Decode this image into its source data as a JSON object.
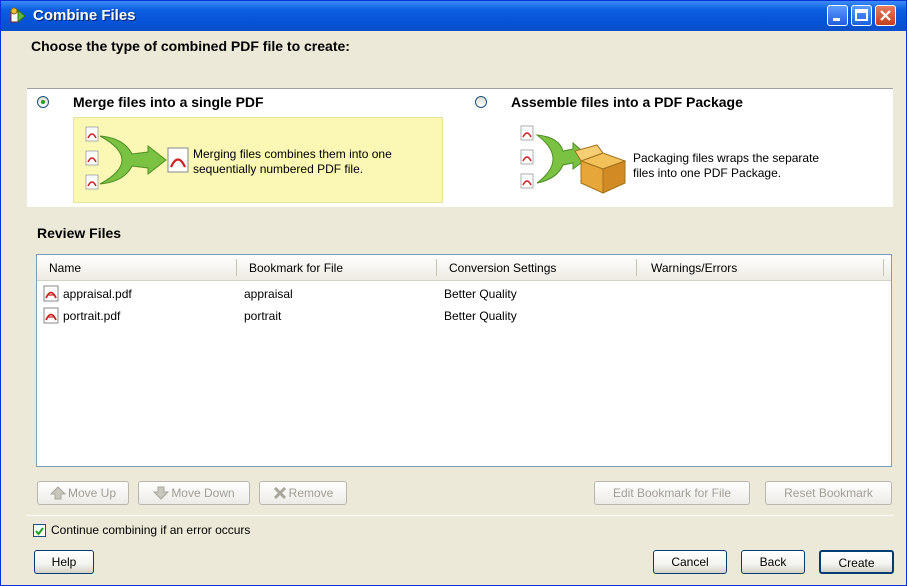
{
  "window": {
    "title": "Combine Files"
  },
  "heading": "Choose the type of combined PDF file to create:",
  "options": {
    "merge": {
      "label": "Merge files into a single PDF",
      "description_line1": "Merging files combines them into one",
      "description_line2": "sequentially numbered PDF file.",
      "selected": true
    },
    "package": {
      "label": "Assemble files into a PDF Package",
      "description_line1": "Packaging files wraps the separate",
      "description_line2": "files into one PDF Package.",
      "selected": false
    }
  },
  "review": {
    "title": "Review Files",
    "columns": [
      "Name",
      "Bookmark for File",
      "Conversion Settings",
      "Warnings/Errors"
    ],
    "rows": [
      {
        "name": "appraisal.pdf",
        "bookmark": "appraisal",
        "conversion": "Better Quality",
        "warnings": ""
      },
      {
        "name": "portrait.pdf",
        "bookmark": "portrait",
        "conversion": "Better Quality",
        "warnings": ""
      }
    ]
  },
  "list_buttons": {
    "move_up": "Move Up",
    "move_down": "Move Down",
    "remove": "Remove",
    "edit_bookmark": "Edit Bookmark for File",
    "reset_bookmark": "Reset Bookmark"
  },
  "continue_checkbox": {
    "label": "Continue combining if an error occurs",
    "checked": true
  },
  "footer_buttons": {
    "help": "Help",
    "cancel": "Cancel",
    "back": "Back",
    "create": "Create"
  },
  "colors": {
    "titlebar": "#0653D8",
    "dialog_bg": "#ECE9D8",
    "merge_highlight": "#FAF8B4",
    "arrow_green": "#7CC242",
    "pdf_red": "#CC2222"
  },
  "icons": {
    "title": "combine-files-icon",
    "pdf": "pdf-file-icon",
    "move_up": "arrow-up-icon",
    "move_down": "arrow-down-icon",
    "remove": "x-remove-icon"
  }
}
